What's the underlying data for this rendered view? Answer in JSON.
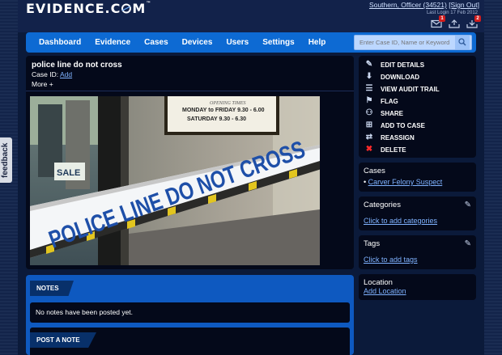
{
  "header": {
    "logo": "EVIDENCE.C",
    "logo_tail": "M",
    "logo_tm": "™",
    "user": "Southern, Officer (34521)",
    "sign_out": "[Sign Out]",
    "last_login": "Last Login 17 Feb 2012",
    "badges": [
      "1",
      "2"
    ]
  },
  "nav": {
    "items": [
      "Dashboard",
      "Evidence",
      "Cases",
      "Devices",
      "Users",
      "Settings",
      "Help"
    ],
    "search_placeholder": "Enter Case ID, Name or Keyword"
  },
  "evidence": {
    "title": "police line do not cross",
    "case_id_label": "Case ID:",
    "case_id_link": "Add",
    "more": "More +",
    "photo": {
      "sign_line1": "OPENING TIMES",
      "sign_line2": "MONDAY to FRIDAY 9.30 - 6.00",
      "sign_line3": "SATURDAY 9.30 - 6.30",
      "sale": "SALE",
      "tape_text": "POLICE LINE DO NOT CROSS"
    }
  },
  "actions": [
    {
      "label": "EDIT DETAILS",
      "icon": "pencil-icon"
    },
    {
      "label": "DOWNLOAD",
      "icon": "download-icon"
    },
    {
      "label": "VIEW AUDIT TRAIL",
      "icon": "list-icon"
    },
    {
      "label": "FLAG",
      "icon": "flag-icon"
    },
    {
      "label": "SHARE",
      "icon": "share-icon"
    },
    {
      "label": "ADD TO CASE",
      "icon": "folder-plus-icon"
    },
    {
      "label": "REASSIGN",
      "icon": "reassign-icon"
    },
    {
      "label": "DELETE",
      "icon": "delete-icon"
    }
  ],
  "cases": {
    "title": "Cases",
    "items": [
      "Carver Felony Suspect"
    ]
  },
  "categories": {
    "title": "Categories",
    "link": "Click to add categories"
  },
  "tags": {
    "title": "Tags",
    "link": "Click to add tags"
  },
  "location": {
    "title": "Location",
    "link": "Add Location"
  },
  "notes": {
    "tab": "NOTES",
    "empty": "No notes have been posted yet.",
    "post_tab": "POST A NOTE"
  },
  "feedback": "feedback",
  "colors": {
    "page_bg": "#0b1a3a",
    "nav_blue": "#0d6ad3",
    "panel_dark": "#04091a",
    "link": "#7fb2ff",
    "delete_red": "#ff2a2a",
    "badge_red": "#d21d1d"
  }
}
